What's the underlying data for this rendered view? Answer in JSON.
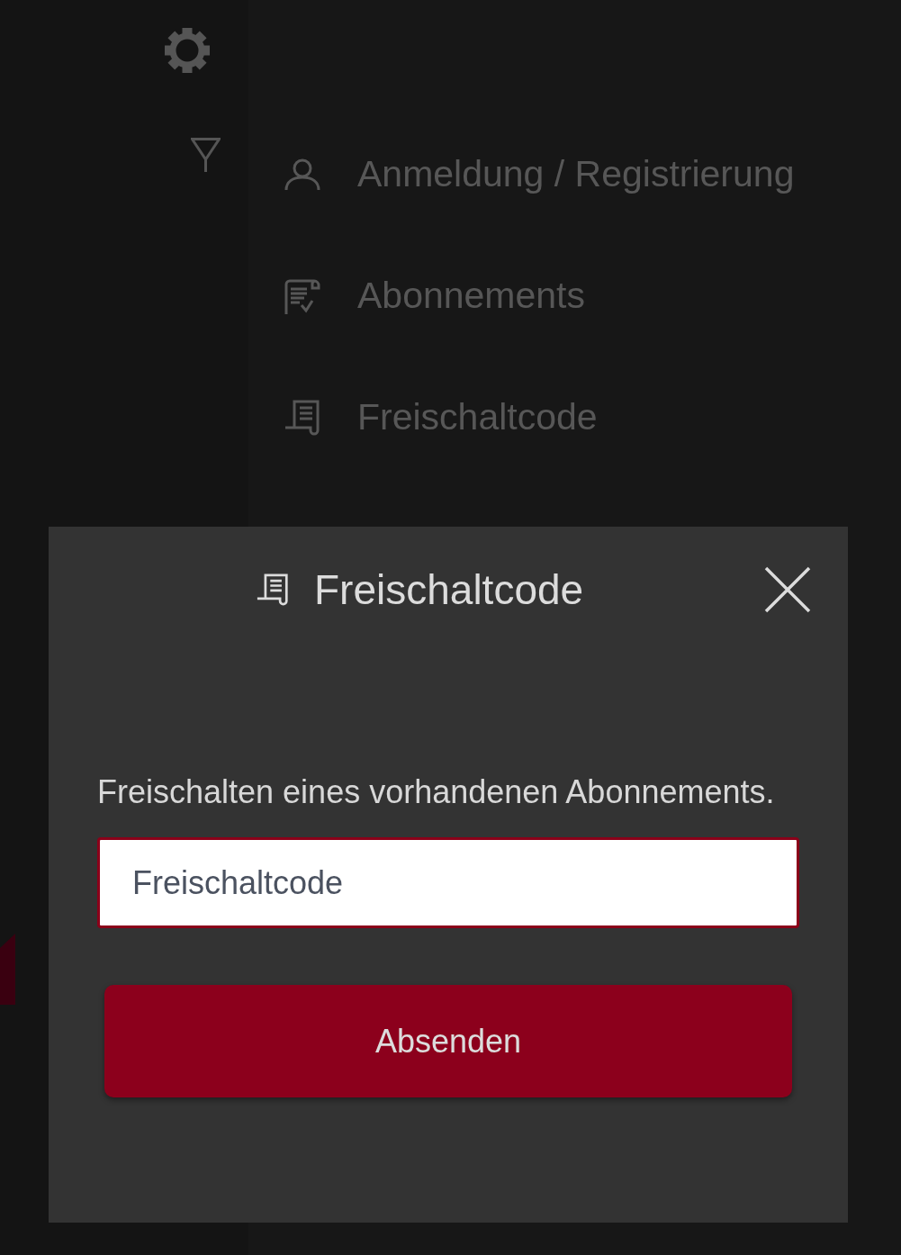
{
  "menu": {
    "items": [
      {
        "label": "Anmeldung / Registrierung"
      },
      {
        "label": "Abonnements"
      },
      {
        "label": "Freischaltcode"
      }
    ]
  },
  "dialog": {
    "title": "Freischaltcode",
    "description": "Freischalten eines vorhandenen Abonnements.",
    "input": {
      "placeholder": "Freischaltcode"
    },
    "submit_button": "Absenden"
  }
}
